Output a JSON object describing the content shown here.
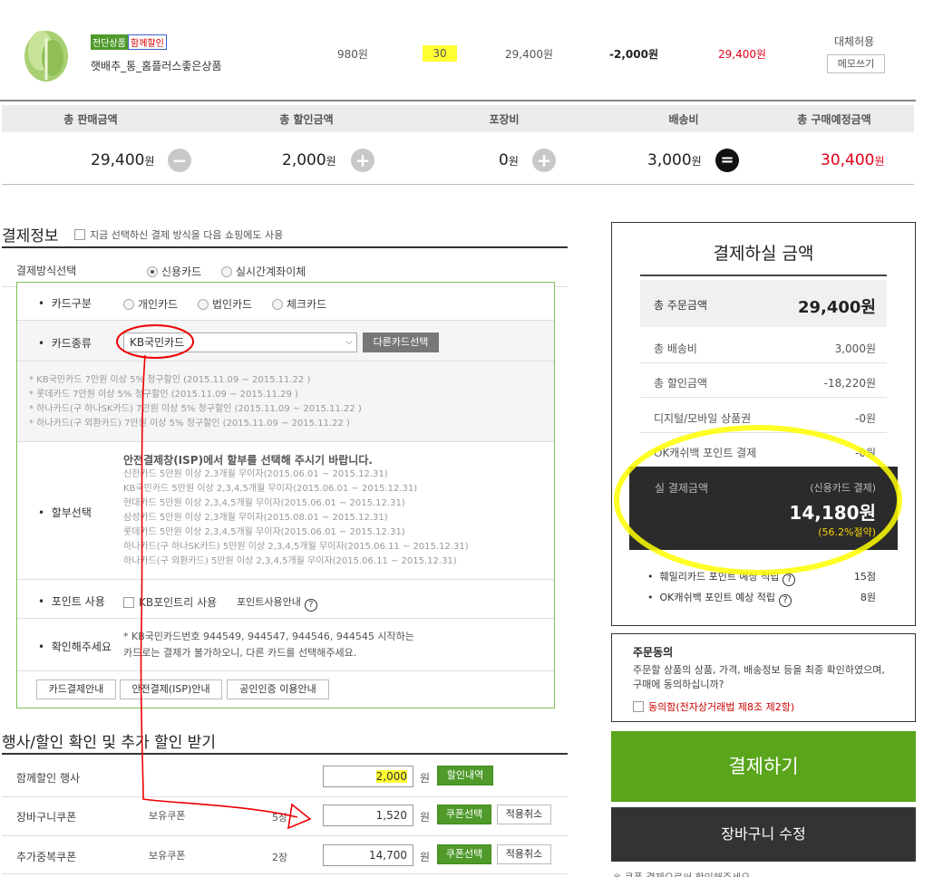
{
  "product": {
    "badge_new": "전단상품",
    "badge_sale": "함께할인",
    "name": "햇배추_통_홈플러스좋은상품",
    "unit_price": "980원",
    "qty": "30",
    "price": "29,400원",
    "discount": "-2,000원",
    "final": "29,400원",
    "substitute": "대체허용",
    "memo_btn": "메모쓰기"
  },
  "summary": {
    "headers": [
      "총 판매금액",
      "총 할인금액",
      "포장비",
      "배송비",
      "총 구매예정금액"
    ],
    "values": [
      "29,400",
      "2,000",
      "0",
      "3,000",
      "30,400"
    ],
    "unit": "원"
  },
  "payment": {
    "title": "결제정보",
    "remember": "지금 선택하신 결제 방식을 다음 쇼핑에도 사용",
    "method_label": "결제방식선택",
    "method_card": "신용카드",
    "method_transfer": "실시간계좌이체",
    "card_type_label": "카드구분",
    "card_type_options": [
      "개인카드",
      "법인카드",
      "체크카드"
    ],
    "card_kind_label": "카드종류",
    "card_kind_value": "KB국민카드",
    "other_card_btn": "다른카드선택",
    "promos": [
      "* KB국민카드 7만원 이상 5% 청구할인 (2015.11.09 ~ 2015.11.22 )",
      "* 롯데카드 7만원 이상 5% 청구할인 (2015.11.09 ~ 2015.11.29 )",
      "* 하나카드(구 하나SK카드) 7만원 이상 5% 청구할인 (2015.11.09 ~ 2015.11.22 )",
      "* 하나카드(구 외환카드) 7만원 이상 5% 청구할인 (2015.11.09 ~ 2015.11.22 )"
    ],
    "installment_label": "할부선택",
    "installment_title": "안전결제창(ISP)에서 할부를 선택해 주시기 바랍니다.",
    "installments": [
      "신한카드 5만원 이상 2,3개월 무이자(2015.06.01 ~ 2015.12.31)",
      "KB국민카드 5만원 이상 2,3,4,5개월 무이자(2015.06.01 ~ 2015.12.31)",
      "현대카드 5만원 이상 2,3,4,5개월 무이자(2015.06.01 ~ 2015.12.31)",
      "삼성카드 5만원 이상 2,3개월 무이자(2015.08.01 ~ 2015.12.31)",
      "롯데카드 5만원 이상 2,3,4,5개월 무이자(2015.06.01 ~ 2015.12.31)",
      "하나카드(구 하나SK카드) 5만원 이상 2,3,4,5개월 무이자(2015.06.11 ~ 2015.12.31)",
      "하나카드(구 외환카드) 5만원 이상 2,3,4,5개월 무이자(2015.06.11 ~ 2015.12.31)"
    ],
    "point_label": "포인트 사용",
    "point_check": "KB포인트리 사용",
    "point_guide": "포인트사용안내",
    "confirm_label": "확인해주세요",
    "confirm_text_1": "* KB국민카드번호 944549, 944547, 944546, 944545 시작하는",
    "confirm_text_2": "카드로는 결제가 불가하오니, 다른 카드를 선택해주세요.",
    "guide_btns": [
      "카드결제안내",
      "안전결제(ISP)안내",
      "공인인증 이용안내"
    ]
  },
  "events": {
    "title": "행사/할인 확인 및 추가 할인 받기",
    "rows": [
      {
        "label": "함께할인 행사",
        "held": "",
        "count": "",
        "value": "2,000",
        "unit": "원",
        "btn": "할인내역",
        "cancel": ""
      },
      {
        "label": "장바구니쿠폰",
        "held": "보유쿠폰",
        "count": "5장",
        "value": "1,520",
        "unit": "원",
        "btn": "쿠폰선택",
        "cancel": "적용취소"
      },
      {
        "label": "추가중복쿠폰",
        "held": "보유쿠폰",
        "count": "2장",
        "value": "14,700",
        "unit": "원",
        "btn": "쿠폰선택",
        "cancel": "적용취소"
      }
    ]
  },
  "side": {
    "title": "결제하실 금액",
    "total_order_label": "총 주문금액",
    "total_order": "29,400원",
    "lines": [
      {
        "label": "총 배송비",
        "value": "3,000원"
      },
      {
        "label": "총 할인금액",
        "value": "-18,220원"
      },
      {
        "label": "디지털/모바일 상품권",
        "value": "-0원"
      },
      {
        "label": "OK캐쉬백 포인트 결제",
        "value": "-0원"
      }
    ],
    "final_label": "실 결제금액",
    "final_method": "(신용카드 결제)",
    "final_amount": "14,180원",
    "final_save": "(56.2%절약)",
    "points": [
      {
        "label": "훼밀리카드 포인트 예상 적립",
        "value": "15점"
      },
      {
        "label": "OK캐쉬백 포인트 예상 적립",
        "value": "8원"
      }
    ],
    "agree_title": "주문동의",
    "agree_text": "주문할 상품의 상품, 가격, 배송정보 등을 최종 확인하였으며, 구매에 동의하십니까?",
    "agree_check": "동의함(전자상거래법 제8조 제2항)",
    "pay_btn": "결제하기",
    "cart_btn": "장바구니 수정",
    "footer_note": "※ 쿠폰 결제으로써 확인해주세요"
  },
  "colors": {
    "green": "#5aa51c",
    "dark": "#2b2b2b",
    "red": "#e0001a",
    "yellow": "#ffff00",
    "save_yellow": "#f5d200"
  }
}
